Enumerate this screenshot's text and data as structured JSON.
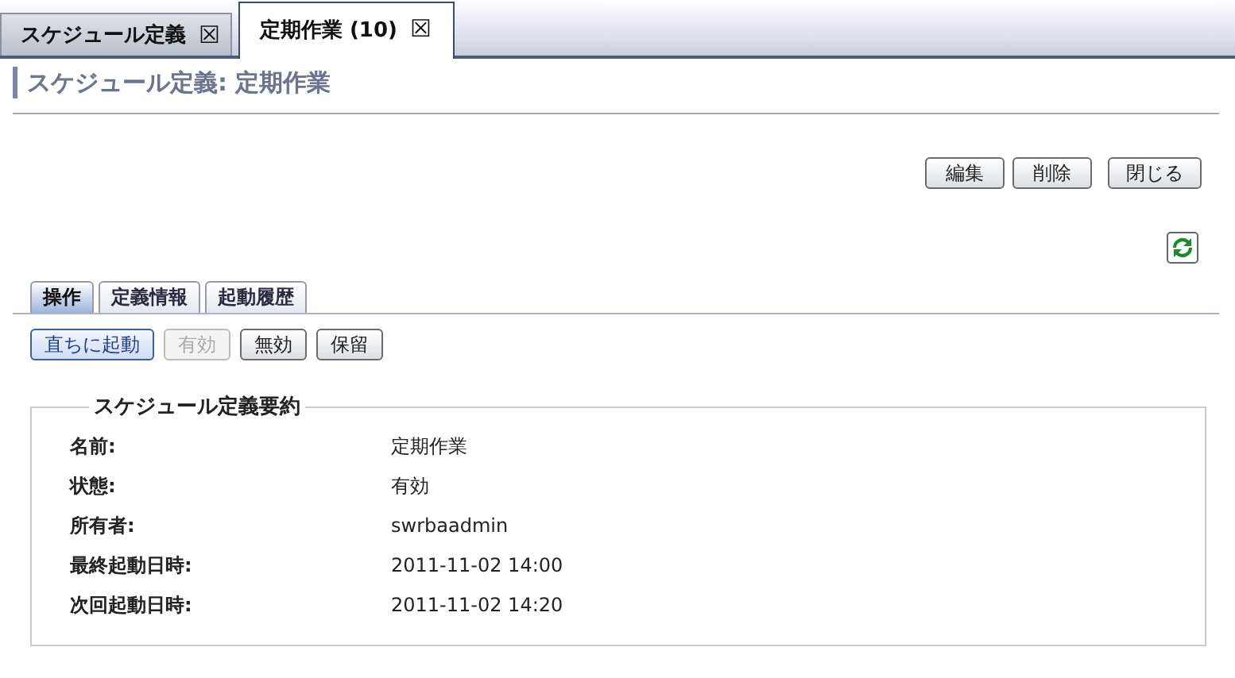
{
  "tabs": [
    {
      "label": "スケジュール定義",
      "close": "☒",
      "selected": false
    },
    {
      "label": "定期作業 (10)",
      "close": "☒",
      "selected": true
    }
  ],
  "title": "スケジュール定義: 定期作業",
  "buttons": [
    "編集",
    "削除",
    "閉じる"
  ],
  "subtabs": [
    {
      "label": "操作",
      "selected": true
    },
    {
      "label": "定義情報",
      "selected": false
    },
    {
      "label": "起動履歴",
      "selected": false
    }
  ],
  "actions": [
    {
      "label": "直ちに起動",
      "kind": "primary",
      "disabled": false
    },
    {
      "label": "有効",
      "kind": "normal",
      "disabled": true
    },
    {
      "label": "無効",
      "kind": "normal",
      "disabled": false
    },
    {
      "label": "保留",
      "kind": "normal",
      "disabled": false
    }
  ],
  "summary": {
    "legend": "スケジュール定義要約",
    "rows": [
      {
        "label": "名前:",
        "value": "定期作業"
      },
      {
        "label": "状態:",
        "value": "有効"
      },
      {
        "label": "所有者:",
        "value": "swrbaadmin"
      },
      {
        "label": "最終起動日時:",
        "value": "2011-11-02 14:00"
      },
      {
        "label": "次回起動日時:",
        "value": "2011-11-02 14:20"
      }
    ]
  }
}
